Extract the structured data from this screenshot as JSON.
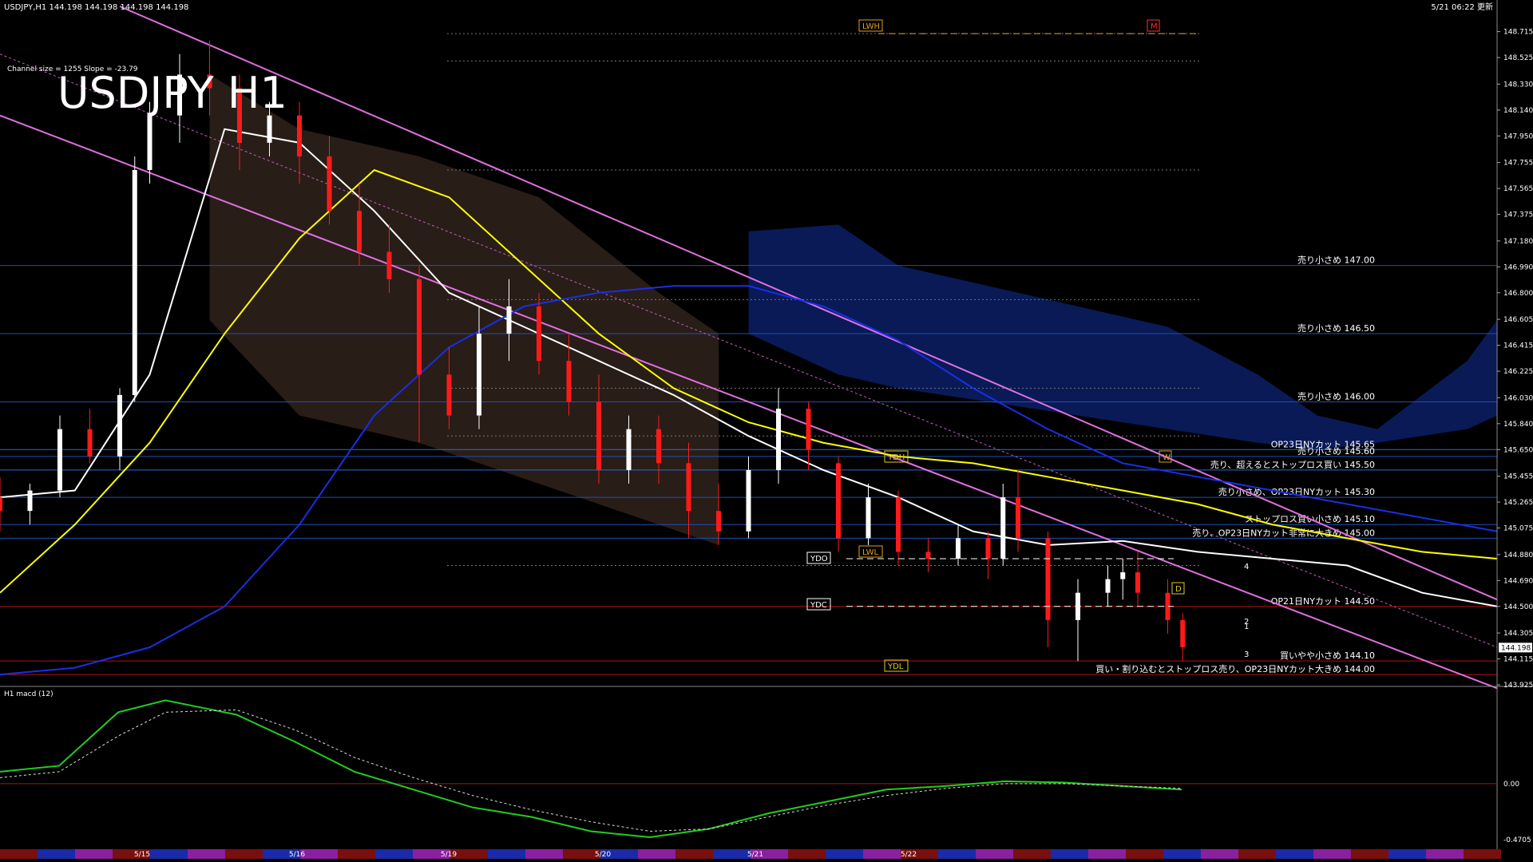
{
  "header": {
    "symbol_line": "USDJPY,H1  144.198 144.198 144.198 144.198",
    "updated": "5/21 06:22 更新",
    "channel_info": "Channel size = 1255 Slope = -23.79"
  },
  "chart_data": [
    {
      "type": "line",
      "title": "USDJPY H1",
      "x_labels": [
        "5/15",
        "5/16",
        "5/19",
        "5/20",
        "5/21",
        "5/22"
      ],
      "ylim": [
        143.925,
        148.9
      ],
      "y_ticks": [
        148.715,
        148.525,
        148.33,
        148.14,
        147.95,
        147.755,
        147.565,
        147.375,
        147.18,
        146.99,
        146.8,
        146.605,
        146.415,
        146.225,
        146.03,
        145.84,
        145.65,
        145.455,
        145.265,
        145.075,
        144.88,
        144.69,
        144.5,
        144.305,
        144.115,
        143.925
      ],
      "y_tick_labels": [
        "148.715",
        "148.525",
        "148.330",
        "148.140",
        "147.950",
        "147.755",
        "147.565",
        "147.375",
        "147.180",
        "146.990",
        "146.800",
        "146.605",
        "146.415",
        "146.225",
        "146.030",
        "145.840",
        "145.650",
        "145.455",
        "145.265",
        "145.075",
        "144.880",
        "144.690",
        "144.500",
        "144.305",
        "144.115",
        "143.925"
      ],
      "current_price": "144.198",
      "price_levels": [
        {
          "price": 147.0,
          "label": "売り小さめ 147.00",
          "color": "#1f4fb4"
        },
        {
          "price": 146.5,
          "label": "売り小さめ 146.50",
          "color": "#1f4fb4"
        },
        {
          "price": 146.0,
          "label": "売り小さめ 146.00",
          "color": "#1f4fb4"
        },
        {
          "price": 145.65,
          "label": "OP23日NYカット 145.65",
          "color": "#2a6ad8"
        },
        {
          "price": 145.6,
          "label": "売り小さめ 145.60",
          "color": "#1f4fb4"
        },
        {
          "price": 145.5,
          "label": "売り、超えるとストップロス買い 145.50",
          "color": "#2a6ad8"
        },
        {
          "price": 145.3,
          "label": "売り小さめ、OP23日NYカット 145.30",
          "color": "#1f4fb4"
        },
        {
          "price": 145.1,
          "label": "ストップロス買い小さめ 145.10",
          "color": "#1f4fb4"
        },
        {
          "price": 145.0,
          "label": "売り、OP23日NYカット非常に大きめ 145.00",
          "color": "#1f4fb4"
        },
        {
          "price": 144.5,
          "label": "OP21日NYカット 144.50",
          "color": "#b01010"
        },
        {
          "price": 144.1,
          "label": "買いやや小さめ 144.10",
          "color": "#b01010"
        },
        {
          "price": 144.0,
          "label": "買い・割り込むとストップロス売り、OP23日NYカット大きめ 144.00",
          "color": "#b01010"
        }
      ],
      "reference_labels": {
        "lwh": "LWH",
        "m": "M",
        "ydh": "YDH",
        "w": "W",
        "lwl": "LWL",
        "ydo": "YDO",
        "ydc": "YDC",
        "d": "D",
        "ydl": "YDL"
      },
      "projection_numbers": [
        "1",
        "2",
        "3",
        "4"
      ],
      "series": [
        {
          "name": "",
          "color": "#ffffff",
          "x": [
            0,
            5,
            10,
            15,
            20,
            25,
            30,
            35,
            40,
            45,
            50,
            55,
            60,
            65,
            70,
            75,
            80,
            85,
            90,
            95,
            100
          ],
          "values": [
            145.3,
            145.35,
            146.2,
            148.0,
            147.9,
            147.4,
            146.8,
            146.55,
            146.3,
            146.05,
            145.75,
            145.5,
            145.3,
            145.05,
            144.95,
            144.98,
            144.9,
            144.85,
            144.8,
            144.6,
            144.5
          ]
        },
        {
          "name": "",
          "color": "#ffff00",
          "x": [
            0,
            5,
            10,
            15,
            20,
            25,
            30,
            35,
            40,
            45,
            50,
            55,
            60,
            65,
            70,
            75,
            80,
            85,
            90,
            95,
            100
          ],
          "values": [
            144.6,
            145.1,
            145.7,
            146.5,
            147.2,
            147.7,
            147.5,
            147.0,
            146.5,
            146.1,
            145.85,
            145.7,
            145.6,
            145.55,
            145.45,
            145.35,
            145.25,
            145.1,
            145.0,
            144.9,
            144.85
          ]
        },
        {
          "name": "",
          "color": "#1a2ee8",
          "x": [
            0,
            5,
            10,
            15,
            20,
            25,
            30,
            35,
            40,
            45,
            50,
            55,
            60,
            65,
            70,
            75,
            80,
            85,
            90,
            95,
            100
          ],
          "values": [
            144.0,
            144.05,
            144.2,
            144.5,
            145.1,
            145.9,
            146.4,
            146.7,
            146.8,
            146.85,
            146.85,
            146.7,
            146.45,
            146.1,
            145.8,
            145.55,
            145.45,
            145.35,
            145.25,
            145.15,
            145.05
          ]
        }
      ],
      "candles": [
        {
          "x": 0,
          "o": 145.3,
          "h": 145.45,
          "c": 145.2,
          "l": 145.05
        },
        {
          "x": 2,
          "o": 145.2,
          "h": 145.4,
          "c": 145.35,
          "l": 145.1
        },
        {
          "x": 4,
          "o": 145.35,
          "h": 145.9,
          "c": 145.8,
          "l": 145.3
        },
        {
          "x": 6,
          "o": 145.8,
          "h": 145.95,
          "c": 145.6,
          "l": 145.55
        },
        {
          "x": 8,
          "o": 145.6,
          "h": 146.1,
          "c": 146.05,
          "l": 145.5
        },
        {
          "x": 9,
          "o": 146.05,
          "h": 147.8,
          "c": 147.7,
          "l": 146.0
        },
        {
          "x": 10,
          "o": 147.7,
          "h": 148.2,
          "c": 148.1,
          "l": 147.6
        },
        {
          "x": 12,
          "o": 148.1,
          "h": 148.55,
          "c": 148.4,
          "l": 147.9
        },
        {
          "x": 14,
          "o": 148.4,
          "h": 148.65,
          "c": 148.3,
          "l": 148.1
        },
        {
          "x": 16,
          "o": 148.3,
          "h": 148.4,
          "c": 147.9,
          "l": 147.7
        },
        {
          "x": 18,
          "o": 147.9,
          "h": 148.2,
          "c": 148.1,
          "l": 147.8
        },
        {
          "x": 20,
          "o": 148.1,
          "h": 148.2,
          "c": 147.8,
          "l": 147.6
        },
        {
          "x": 22,
          "o": 147.8,
          "h": 147.95,
          "c": 147.4,
          "l": 147.3
        },
        {
          "x": 24,
          "o": 147.4,
          "h": 147.6,
          "c": 147.1,
          "l": 147.0
        },
        {
          "x": 26,
          "o": 147.1,
          "h": 147.3,
          "c": 146.9,
          "l": 146.8
        },
        {
          "x": 28,
          "o": 146.9,
          "h": 147.0,
          "c": 146.2,
          "l": 145.7
        },
        {
          "x": 30,
          "o": 146.2,
          "h": 146.4,
          "c": 145.9,
          "l": 145.8
        },
        {
          "x": 32,
          "o": 145.9,
          "h": 146.7,
          "c": 146.5,
          "l": 145.8
        },
        {
          "x": 34,
          "o": 146.5,
          "h": 146.9,
          "c": 146.7,
          "l": 146.3
        },
        {
          "x": 36,
          "o": 146.7,
          "h": 146.8,
          "c": 146.3,
          "l": 146.2
        },
        {
          "x": 38,
          "o": 146.3,
          "h": 146.5,
          "c": 146.0,
          "l": 145.9
        },
        {
          "x": 40,
          "o": 146.0,
          "h": 146.2,
          "c": 145.5,
          "l": 145.4
        },
        {
          "x": 42,
          "o": 145.5,
          "h": 145.9,
          "c": 145.8,
          "l": 145.4
        },
        {
          "x": 44,
          "o": 145.8,
          "h": 145.9,
          "c": 145.55,
          "l": 145.4
        },
        {
          "x": 46,
          "o": 145.55,
          "h": 145.7,
          "c": 145.2,
          "l": 145.0
        },
        {
          "x": 48,
          "o": 145.2,
          "h": 145.4,
          "c": 145.05,
          "l": 144.95
        },
        {
          "x": 50,
          "o": 145.05,
          "h": 145.6,
          "c": 145.5,
          "l": 145.0
        },
        {
          "x": 52,
          "o": 145.5,
          "h": 146.1,
          "c": 145.95,
          "l": 145.4
        },
        {
          "x": 54,
          "o": 145.95,
          "h": 146.0,
          "c": 145.65,
          "l": 145.5
        },
        {
          "x": 56,
          "o": 145.55,
          "h": 145.6,
          "c": 145.0,
          "l": 144.9
        },
        {
          "x": 58,
          "o": 145.0,
          "h": 145.4,
          "c": 145.3,
          "l": 144.95
        },
        {
          "x": 60,
          "o": 145.3,
          "h": 145.35,
          "c": 144.9,
          "l": 144.8
        },
        {
          "x": 62,
          "o": 144.9,
          "h": 145.0,
          "c": 144.85,
          "l": 144.75
        },
        {
          "x": 64,
          "o": 144.85,
          "h": 145.1,
          "c": 145.0,
          "l": 144.8
        },
        {
          "x": 66,
          "o": 145.0,
          "h": 145.05,
          "c": 144.85,
          "l": 144.7
        },
        {
          "x": 67,
          "o": 144.85,
          "h": 145.4,
          "c": 145.3,
          "l": 144.8
        },
        {
          "x": 68,
          "o": 145.3,
          "h": 145.5,
          "c": 145.0,
          "l": 144.9
        },
        {
          "x": 70,
          "o": 145.0,
          "h": 145.05,
          "c": 144.4,
          "l": 144.2
        },
        {
          "x": 72,
          "o": 144.4,
          "h": 144.7,
          "c": 144.6,
          "l": 144.1
        },
        {
          "x": 74,
          "o": 144.6,
          "h": 144.8,
          "c": 144.7,
          "l": 144.5
        },
        {
          "x": 75,
          "o": 144.7,
          "h": 144.85,
          "c": 144.75,
          "l": 144.55
        },
        {
          "x": 76,
          "o": 144.75,
          "h": 144.9,
          "c": 144.6,
          "l": 144.5
        },
        {
          "x": 78,
          "o": 144.6,
          "h": 144.7,
          "c": 144.4,
          "l": 144.3
        },
        {
          "x": 79,
          "o": 144.4,
          "h": 144.45,
          "c": 144.2,
          "l": 144.1
        }
      ]
    },
    {
      "type": "line",
      "title": "H1  macd (12)",
      "ylim": [
        -0.4705,
        0.75
      ],
      "y_ticks": [
        0.0,
        -0.4705
      ],
      "y_tick_labels": [
        "0.00",
        "-0.4705"
      ],
      "series": [
        {
          "name": "",
          "color": "#22cc22",
          "x": [
            0,
            5,
            10,
            14,
            20,
            25,
            30,
            35,
            40,
            45,
            50,
            55,
            60,
            65,
            70,
            75,
            80,
            85,
            90,
            95,
            100
          ],
          "values": [
            0.1,
            0.15,
            0.6,
            0.7,
            0.58,
            0.35,
            0.1,
            -0.05,
            -0.2,
            -0.28,
            -0.4,
            -0.45,
            -0.38,
            -0.25,
            -0.15,
            -0.05,
            -0.02,
            0.02,
            0.01,
            -0.02,
            -0.05
          ]
        },
        {
          "name": "",
          "color": "#dddddd",
          "x": [
            0,
            5,
            10,
            14,
            20,
            25,
            30,
            35,
            40,
            45,
            50,
            55,
            60,
            65,
            70,
            75,
            80,
            85,
            90,
            95,
            100
          ],
          "values": [
            0.05,
            0.1,
            0.4,
            0.6,
            0.62,
            0.45,
            0.22,
            0.05,
            -0.1,
            -0.22,
            -0.32,
            -0.4,
            -0.38,
            -0.28,
            -0.18,
            -0.1,
            -0.04,
            0.0,
            0.0,
            -0.02,
            -0.04
          ]
        }
      ]
    }
  ],
  "date_strip": {
    "labels": [
      "5/15",
      "5/16",
      "5/19",
      "5/20",
      "5/21",
      "5/22"
    ]
  },
  "colors": {
    "background": "#000000",
    "bull": "#ffffff",
    "bear": "#ff1a1a",
    "grid": "#3a3a3a",
    "axis_text": "#ffffff"
  }
}
